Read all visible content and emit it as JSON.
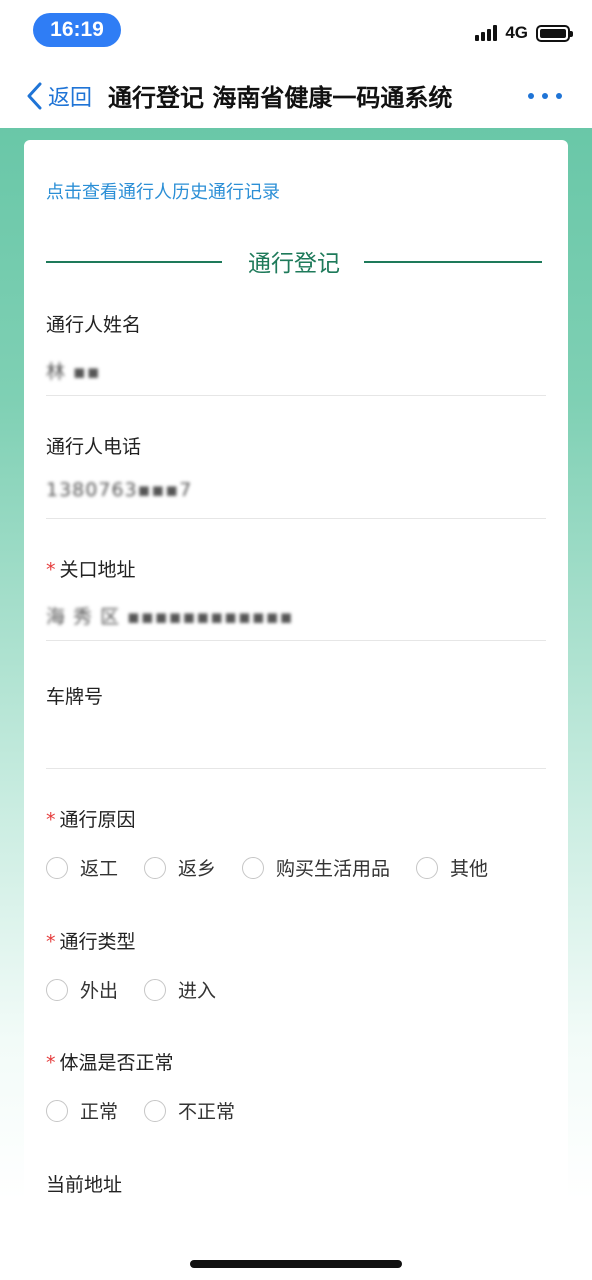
{
  "status_bar": {
    "time": "16:19",
    "network": "4G"
  },
  "nav": {
    "back_label": "返回",
    "title": "通行登记 海南省健康一码通系统"
  },
  "card": {
    "history_link": "点击查看通行人历史通行记录",
    "section_title": "通行登记",
    "fields": {
      "name": {
        "label": "通行人姓名",
        "value": "林 ▪▪"
      },
      "phone": {
        "label": "通行人电话",
        "value": "1380763▪▪▪7"
      },
      "checkpoint": {
        "required_mark": "*",
        "label": "关口地址",
        "value": "海 秀 区 ▪▪▪▪▪▪▪▪▪▪▪▪"
      },
      "plate": {
        "label": "车牌号",
        "value": ""
      },
      "reason": {
        "required_mark": "*",
        "label": "通行原因",
        "options": [
          "返工",
          "返乡",
          "购买生活用品",
          "其他"
        ]
      },
      "type": {
        "required_mark": "*",
        "label": "通行类型",
        "options": [
          "外出",
          "进入"
        ]
      },
      "temperature": {
        "required_mark": "*",
        "label": "体温是否正常",
        "options": [
          "正常",
          "不正常"
        ]
      },
      "current_address": {
        "label": "当前地址",
        "value": ""
      }
    }
  },
  "colors": {
    "accent_blue": "#1f74d6",
    "link_blue": "#2b8fd6",
    "section_green": "#1e7a5a",
    "required_red": "#e53b3b",
    "time_pill": "#2f7df5"
  }
}
